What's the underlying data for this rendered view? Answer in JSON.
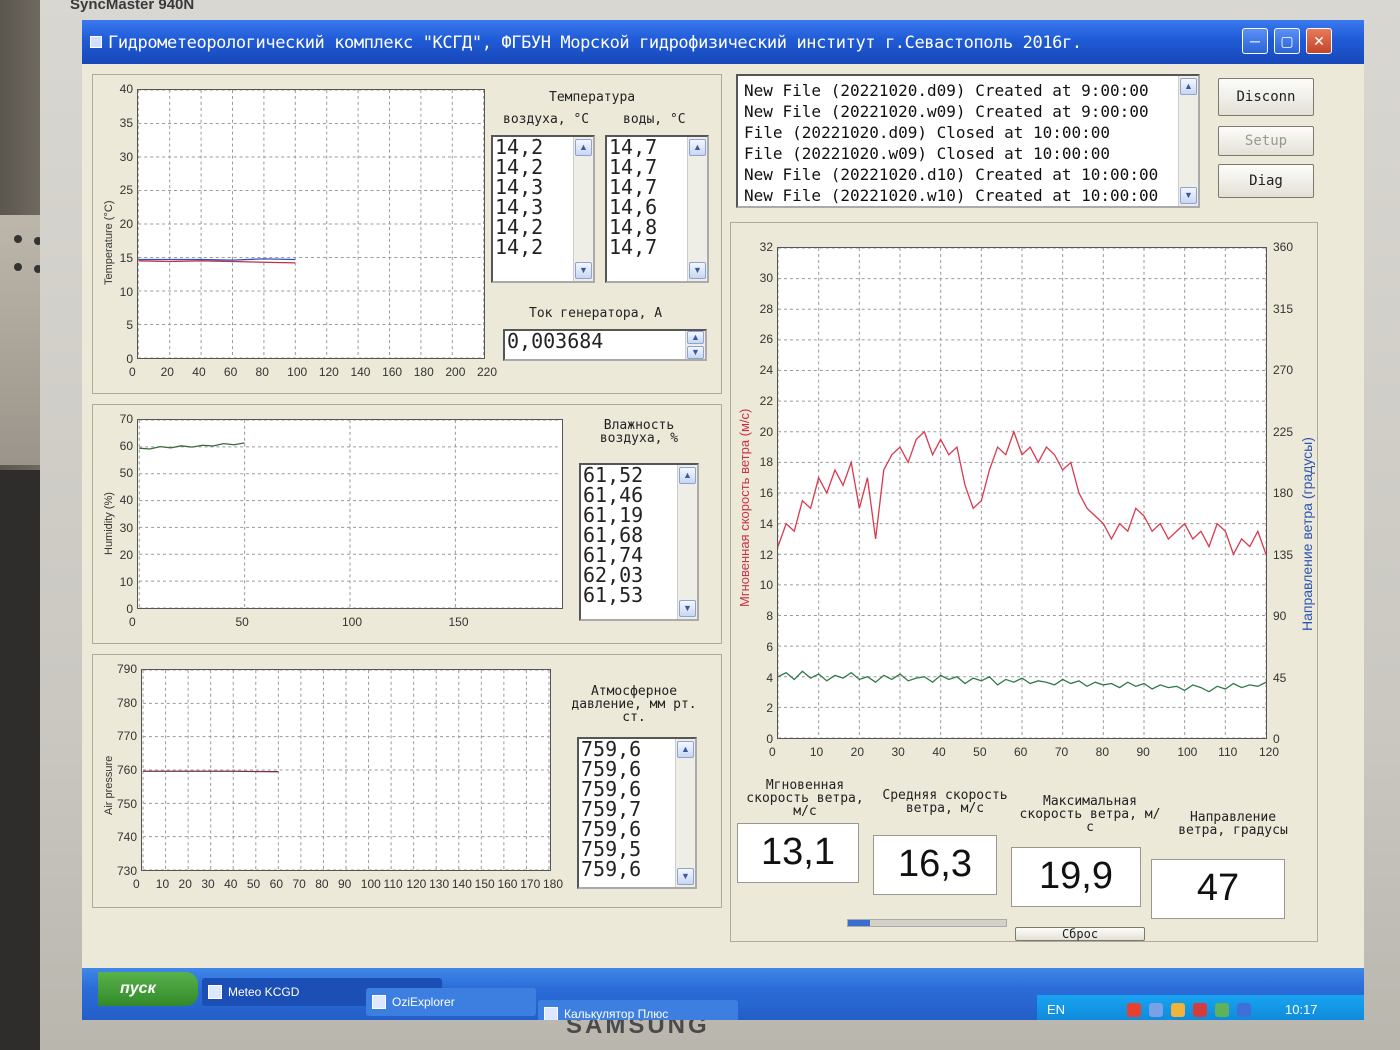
{
  "monitor": {
    "model": "SyncMaster 940N",
    "brand": "SAMSUNG"
  },
  "window": {
    "title": "Гидрометеорологический комплекс \"КСГД\", ФГБУН Морской гидрофизический институт г.Севастополь 2016г."
  },
  "temperature": {
    "heading": "Температура",
    "air_label": "воздуха, °С",
    "water_label": "воды, °С",
    "air_values": [
      "14,2",
      "14,2",
      "14,3",
      "14,3",
      "14,2",
      "14,2"
    ],
    "water_values": [
      "14,7",
      "14,7",
      "14,7",
      "14,6",
      "14,8",
      "14,7"
    ],
    "generator_label": "Ток генератора, А",
    "generator_value": "0,003684",
    "ylabel": "Temperature (°C)"
  },
  "humidity": {
    "heading": "Влажность воздуха, %",
    "values": [
      "61,52",
      "61,46",
      "61,19",
      "61,68",
      "61,74",
      "62,03",
      "61,53"
    ],
    "ylabel": "Humidity (%)"
  },
  "pressure": {
    "heading": "Атмосферное давление, мм рт. ст.",
    "values": [
      "759,6",
      "759,6",
      "759,6",
      "759,7",
      "759,6",
      "759,5",
      "759,6"
    ],
    "ylabel": "Air pressure"
  },
  "log": {
    "lines": [
      "New File (20221020.d09) Created at 9:00:00",
      "New File (20221020.w09) Created at 9:00:00",
      "File (20221020.d09) Closed at 10:00:00",
      "File (20221020.w09) Closed at 10:00:00",
      "New File (20221020.d10) Created at 10:00:00",
      "New File (20221020.w10) Created at 10:00:00"
    ]
  },
  "buttons": {
    "disconnect": "Disconn",
    "setup": "Setup",
    "diag": "Diag",
    "reset": "Сброс"
  },
  "wind": {
    "ylabel_left": "Мгновенная скорость ветра (м/с)",
    "ylabel_right": "Направление ветра (градусы)",
    "inst_label": "Мгновенная скорость ветра, м/с",
    "avg_label": "Средняя скорость ветра, м/с",
    "max_label": "Максимальная скорость ветра, м/с",
    "dir_label": "Направление ветра, градусы",
    "inst_value": "13,1",
    "avg_value": "16,3",
    "max_value": "19,9",
    "dir_value": "47"
  },
  "taskbar": {
    "start": "пуск",
    "tasks": [
      "Meteo KCGD",
      "OziExplorer",
      "Калькулятор Плюс"
    ],
    "lang": "EN",
    "time": "10:17"
  },
  "colors": {
    "speed": "#d8394f",
    "direction": "#2f7a45",
    "temp_air": "#c0304a",
    "temp_water": "#3050c0",
    "titlebar": "#1f5bd6"
  },
  "chart_data": [
    {
      "type": "line",
      "ylabel": "Temperature (°C)",
      "xlim": [
        0,
        220
      ],
      "ylim": [
        0,
        40
      ],
      "xticks": [
        0,
        20,
        40,
        60,
        80,
        100,
        120,
        140,
        160,
        180,
        200,
        220
      ],
      "yticks": [
        0,
        5,
        10,
        15,
        20,
        25,
        30,
        35,
        40
      ],
      "series": [
        {
          "x": [
            0,
            20,
            40,
            60,
            80,
            100
          ],
          "values": [
            14.5,
            14.4,
            14.5,
            14.4,
            14.3,
            14.2
          ]
        },
        {
          "x": [
            0,
            20,
            40,
            60,
            80,
            100
          ],
          "values": [
            14.7,
            14.7,
            14.7,
            14.6,
            14.8,
            14.7
          ]
        }
      ]
    },
    {
      "type": "line",
      "ylabel": "Humidity (%)",
      "xlim": [
        0,
        200
      ],
      "ylim": [
        0,
        70
      ],
      "xticks": [
        0,
        50,
        100,
        150
      ],
      "yticks": [
        0,
        10,
        20,
        30,
        40,
        50,
        60,
        70
      ],
      "series": [
        {
          "x": [
            0,
            5,
            10,
            15,
            20,
            25,
            30,
            35,
            40,
            45,
            50
          ],
          "values": [
            59.5,
            59.2,
            60.1,
            59.6,
            60.4,
            59.9,
            60.6,
            60.3,
            61.2,
            60.8,
            61.5
          ]
        }
      ]
    },
    {
      "type": "line",
      "ylabel": "Air pressure",
      "xlim": [
        0,
        180
      ],
      "ylim": [
        730,
        790
      ],
      "xticks": [
        0,
        10,
        20,
        30,
        40,
        50,
        60,
        70,
        80,
        90,
        100,
        110,
        120,
        130,
        140,
        150,
        160,
        170,
        180
      ],
      "yticks": [
        730,
        740,
        750,
        760,
        770,
        780,
        790
      ],
      "series": [
        {
          "x": [
            0,
            20,
            40,
            60
          ],
          "values": [
            759.6,
            759.6,
            759.6,
            759.5
          ]
        }
      ]
    },
    {
      "type": "line",
      "ylabel": "Мгновенная скорость ветра (м/с)",
      "y2label": "Направление ветра (градусы)",
      "xlim": [
        0,
        120
      ],
      "ylim": [
        0,
        32
      ],
      "y2lim": [
        0,
        360
      ],
      "xticks": [
        0,
        10,
        20,
        30,
        40,
        50,
        60,
        70,
        80,
        90,
        100,
        110,
        120
      ],
      "yticks": [
        0,
        2,
        4,
        6,
        8,
        10,
        12,
        14,
        16,
        18,
        20,
        22,
        24,
        26,
        28,
        30,
        32
      ],
      "y2ticks": [
        0,
        45,
        90,
        135,
        180,
        225,
        270,
        315,
        360
      ],
      "series": [
        {
          "axis": "left",
          "x": [
            0,
            2,
            4,
            6,
            8,
            10,
            12,
            14,
            16,
            18,
            20,
            22,
            24,
            26,
            28,
            30,
            32,
            34,
            36,
            38,
            40,
            42,
            44,
            46,
            48,
            50,
            52,
            54,
            56,
            58,
            60,
            62,
            64,
            66,
            68,
            70,
            72,
            74,
            76,
            78,
            80,
            82,
            84,
            86,
            88,
            90,
            92,
            94,
            96,
            98,
            100,
            102,
            104,
            106,
            108,
            110,
            112,
            114,
            116,
            118,
            120
          ],
          "values": [
            12.5,
            14,
            13.5,
            15.5,
            15,
            17,
            16,
            17.5,
            16.5,
            18,
            15,
            17,
            13,
            17.5,
            18.5,
            19,
            18,
            19.5,
            20,
            18.5,
            19.5,
            18.5,
            19,
            16.5,
            15,
            15.5,
            17.5,
            19,
            18.5,
            20,
            18.5,
            19,
            18,
            19,
            18.5,
            17.5,
            18,
            16,
            15,
            14.5,
            14,
            13,
            14,
            13.5,
            15,
            14.5,
            13.5,
            14,
            13,
            13.5,
            14,
            13,
            13.5,
            12.5,
            14,
            13.5,
            12,
            13,
            12.5,
            13.5,
            12
          ]
        },
        {
          "axis": "right",
          "x": [
            0,
            2,
            4,
            6,
            8,
            10,
            12,
            14,
            16,
            18,
            20,
            22,
            24,
            26,
            28,
            30,
            32,
            34,
            36,
            38,
            40,
            42,
            44,
            46,
            48,
            50,
            52,
            54,
            56,
            58,
            60,
            62,
            64,
            66,
            68,
            70,
            72,
            74,
            76,
            78,
            80,
            82,
            84,
            86,
            88,
            90,
            92,
            94,
            96,
            98,
            100,
            102,
            104,
            106,
            108,
            110,
            112,
            114,
            116,
            118,
            120
          ],
          "values": [
            45,
            48,
            43,
            49,
            44,
            47,
            42,
            46,
            44,
            48,
            43,
            45,
            41,
            46,
            43,
            47,
            42,
            44,
            45,
            41,
            46,
            43,
            45,
            40,
            44,
            42,
            45,
            39,
            43,
            41,
            44,
            40,
            42,
            41,
            39,
            43,
            40,
            42,
            38,
            41,
            39,
            40,
            37,
            41,
            38,
            40,
            36,
            39,
            37,
            38,
            35,
            39,
            37,
            34,
            38,
            36,
            40,
            37,
            39,
            38,
            41
          ]
        }
      ]
    }
  ]
}
